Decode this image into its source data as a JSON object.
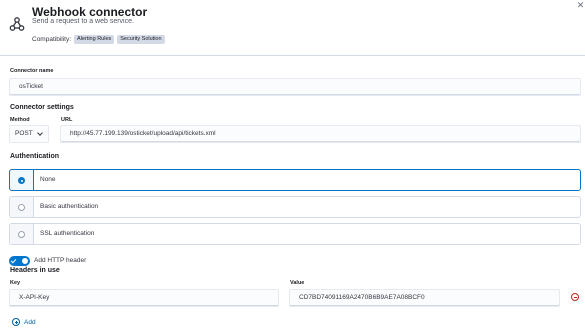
{
  "header": {
    "title": "Webhook connector",
    "subtitle": "Send a request to a web service.",
    "compatibility_label": "Compatibility:",
    "badges": [
      "Alerting Rules",
      "Security Solution"
    ],
    "close_icon": "close-icon",
    "logo_icon": "webhook-icon"
  },
  "connector_name": {
    "label": "Connector name",
    "value": "osTicket"
  },
  "connector_settings": {
    "title": "Connector settings",
    "method_label": "Method",
    "method_value": "POST",
    "url_label": "URL",
    "url_value": "http://45.77.199.139/osticket/upload/api/tickets.xml"
  },
  "authentication": {
    "title": "Authentication",
    "options": [
      {
        "label": "None",
        "selected": true
      },
      {
        "label": "Basic authentication",
        "selected": false
      },
      {
        "label": "SSL authentication",
        "selected": false
      }
    ]
  },
  "http_header": {
    "toggle_label": "Add HTTP header",
    "toggle_on": true,
    "headers_title": "Headers in use",
    "key_label": "Key",
    "value_label": "Value",
    "key_value": "X-API-Key",
    "value_value": "CD7BD74091169A2470B6B9AE7A08BCF0",
    "add_label": "Add"
  },
  "colors": {
    "primary": "#0077cc",
    "danger": "#bd271e",
    "border": "#d3dae6"
  }
}
